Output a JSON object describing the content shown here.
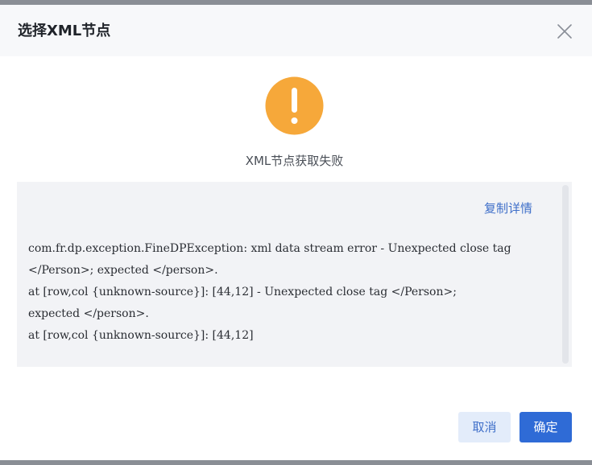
{
  "dialog": {
    "title": "选择XML节点",
    "status_message": "XML节点获取失败",
    "copy_details_label": "复制详情",
    "error_lines": [
      "com.fr.dp.exception.FineDPException: xml data stream error - Unexpected close tag",
      "</Person>; expected </person>.",
      " at [row,col {unknown-source}]: [44,12] - Unexpected close tag </Person>;",
      "expected </person>.",
      " at [row,col {unknown-source}]: [44,12]"
    ],
    "cancel_label": "取消",
    "confirm_label": "确定"
  },
  "icons": {
    "close": "close-icon",
    "status": "warning-icon"
  },
  "colors": {
    "warning": "#F6A83A",
    "primary": "#2F6BD6",
    "link": "#3F6FC9"
  }
}
